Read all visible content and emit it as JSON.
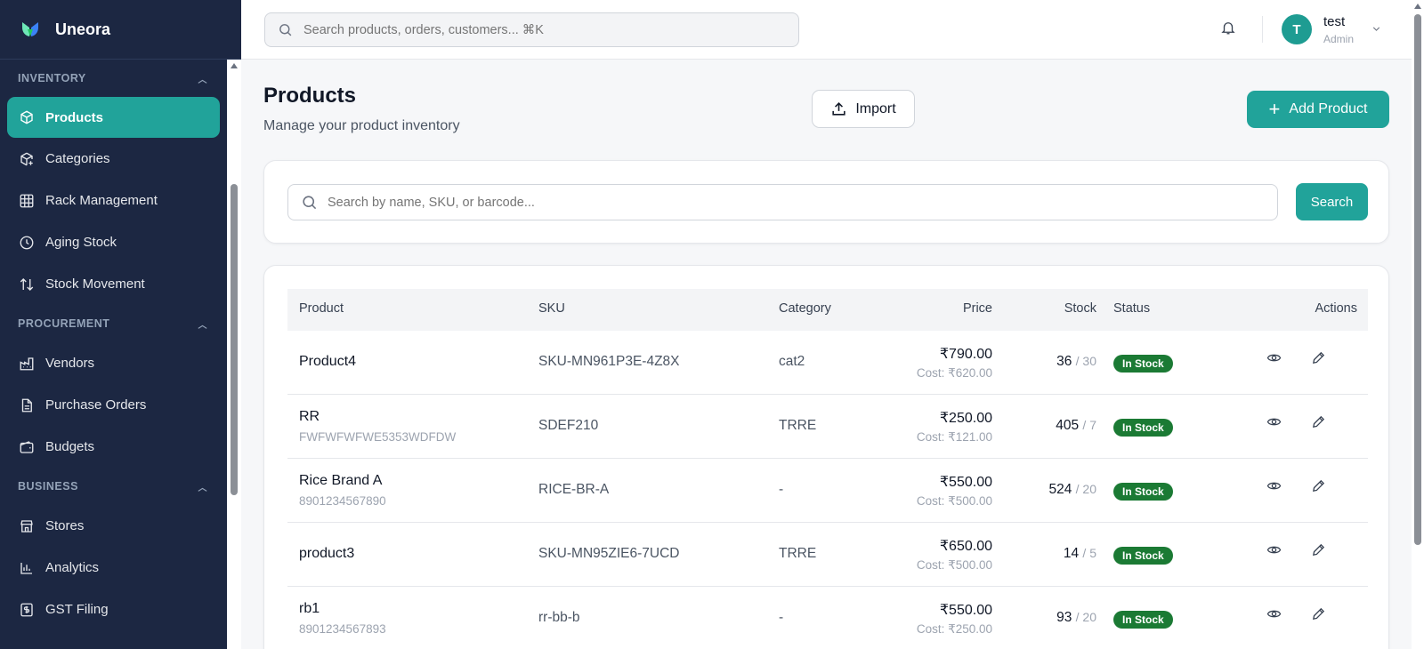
{
  "app": {
    "name": "Uneora"
  },
  "topbar": {
    "search_placeholder": "Search products, orders, customers... ⌘K",
    "user": {
      "initial": "T",
      "name": "test",
      "role": "Admin"
    }
  },
  "sidebar": {
    "sections": [
      {
        "title": "INVENTORY",
        "items": [
          {
            "label": "Products",
            "icon": "box-icon",
            "active": true
          },
          {
            "label": "Categories",
            "icon": "box-plus-icon"
          },
          {
            "label": "Rack Management",
            "icon": "grid-icon"
          },
          {
            "label": "Aging Stock",
            "icon": "clock-icon"
          },
          {
            "label": "Stock Movement",
            "icon": "arrows-updown-icon"
          }
        ]
      },
      {
        "title": "PROCUREMENT",
        "items": [
          {
            "label": "Vendors",
            "icon": "factory-icon"
          },
          {
            "label": "Purchase Orders",
            "icon": "document-icon"
          },
          {
            "label": "Budgets",
            "icon": "wallet-icon"
          }
        ]
      },
      {
        "title": "BUSINESS",
        "items": [
          {
            "label": "Stores",
            "icon": "store-icon"
          },
          {
            "label": "Analytics",
            "icon": "bar-chart-icon"
          },
          {
            "label": "GST Filing",
            "icon": "receipt-icon"
          }
        ]
      }
    ]
  },
  "page": {
    "title": "Products",
    "subtitle": "Manage your product inventory",
    "import_label": "Import",
    "add_label": "Add Product"
  },
  "filter": {
    "placeholder": "Search by name, SKU, or barcode...",
    "button_label": "Search"
  },
  "table": {
    "headers": {
      "product": "Product",
      "sku": "SKU",
      "category": "Category",
      "price": "Price",
      "stock": "Stock",
      "status": "Status",
      "actions": "Actions"
    },
    "rows": [
      {
        "name": "Product4",
        "barcode": "",
        "sku": "SKU-MN961P3E-4Z8X",
        "category": "cat2",
        "price": "₹790.00",
        "cost": "Cost: ₹620.00",
        "stock": "36",
        "min": "/ 30",
        "status": "In Stock"
      },
      {
        "name": "RR",
        "barcode": "FWFWFWFWE5353WDFDW",
        "sku": "SDEF210",
        "category": "TRRE",
        "price": "₹250.00",
        "cost": "Cost: ₹121.00",
        "stock": "405",
        "min": "/ 7",
        "status": "In Stock"
      },
      {
        "name": "Rice Brand A",
        "barcode": "8901234567890",
        "sku": "RICE-BR-A",
        "category": "-",
        "price": "₹550.00",
        "cost": "Cost: ₹500.00",
        "stock": "524",
        "min": "/ 20",
        "status": "In Stock"
      },
      {
        "name": "product3",
        "barcode": "",
        "sku": "SKU-MN95ZIE6-7UCD",
        "category": "TRRE",
        "price": "₹650.00",
        "cost": "Cost: ₹500.00",
        "stock": "14",
        "min": "/ 5",
        "status": "In Stock"
      },
      {
        "name": "rb1",
        "barcode": "8901234567893",
        "sku": "rr-bb-b",
        "category": "-",
        "price": "₹550.00",
        "cost": "Cost: ₹250.00",
        "stock": "93",
        "min": "/ 20",
        "status": "In Stock"
      }
    ]
  },
  "colors": {
    "accent": "#21a39a",
    "sidebar_bg": "#1c2742",
    "badge_green": "#1b7a34"
  }
}
